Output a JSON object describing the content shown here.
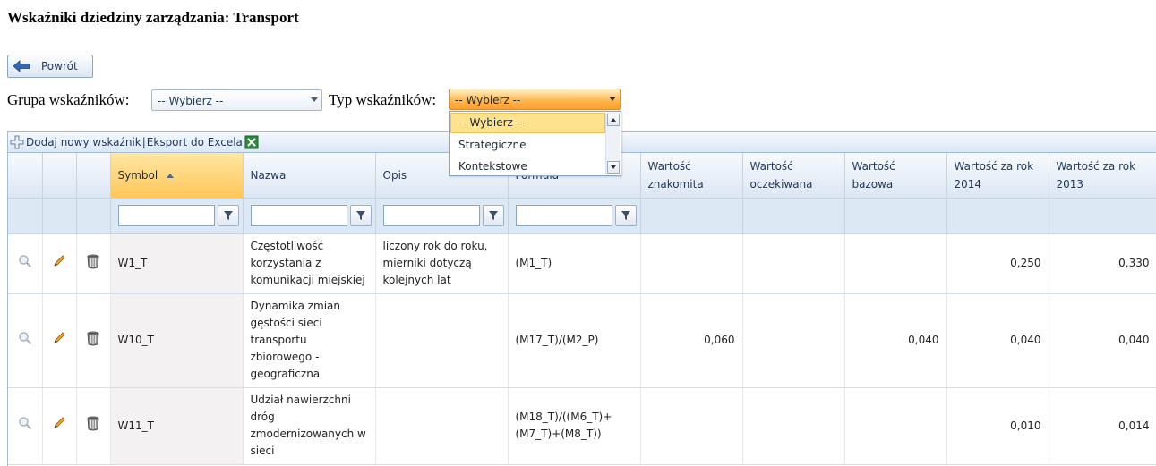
{
  "page": {
    "title": "Wskaźniki dziedziny zarządzania: Transport"
  },
  "back_button": {
    "label": "Powrót",
    "icon": "arrow-left-icon"
  },
  "filters": {
    "group_label": "Grupa wskaźników:",
    "group_value": "-- Wybierz --",
    "type_label": "Typ wskaźników:",
    "type_value": "-- Wybierz --",
    "type_options": [
      "-- Wybierz --",
      "Strategiczne",
      "Kontekstowe"
    ]
  },
  "toolbar": {
    "add_label": "Dodaj nowy wskaźnik",
    "separator": "|",
    "export_label": "Eksport do Excela"
  },
  "grid": {
    "columns": [
      "Symbol",
      "Nazwa",
      "Opis",
      "Formuła",
      "Wartość znakomita",
      "Wartość oczekiwana",
      "Wartość bazowa",
      "Wartość za rok 2014",
      "Wartość za rok 2013"
    ],
    "sorted_column": "Symbol",
    "sort_direction": "ascending",
    "rows": [
      {
        "symbol": "W1_T",
        "name": "Częstotliwość korzystania z komunikacji miejskiej",
        "description": "liczony rok do roku, mierniki dotyczą kolejnych lat",
        "formula": "(M1_T)",
        "excellent": "",
        "expected": "",
        "base": "",
        "year2014": "0,250",
        "year2013": "0,330"
      },
      {
        "symbol": "W10_T",
        "name": "Dynamika zmian gęstości sieci transportu zbiorowego - geograficzna",
        "description": "",
        "formula": "(M17_T)/(M2_P)",
        "excellent": "0,060",
        "expected": "",
        "base": "0,040",
        "year2014": "0,040",
        "year2013": "0,040"
      },
      {
        "symbol": "W11_T",
        "name": "Udział nawierzchni dróg zmodernizowanych w sieci",
        "description": "",
        "formula": "(M18_T)/((M6_T)+(M7_T)+(M8_T))",
        "excellent": "",
        "expected": "",
        "base": "",
        "year2014": "0,010",
        "year2013": "0,014"
      }
    ]
  },
  "colors": {
    "accent_orange": "#ffb449",
    "header_blue": "#dce6f3",
    "border_blue": "#a6bcd6"
  }
}
